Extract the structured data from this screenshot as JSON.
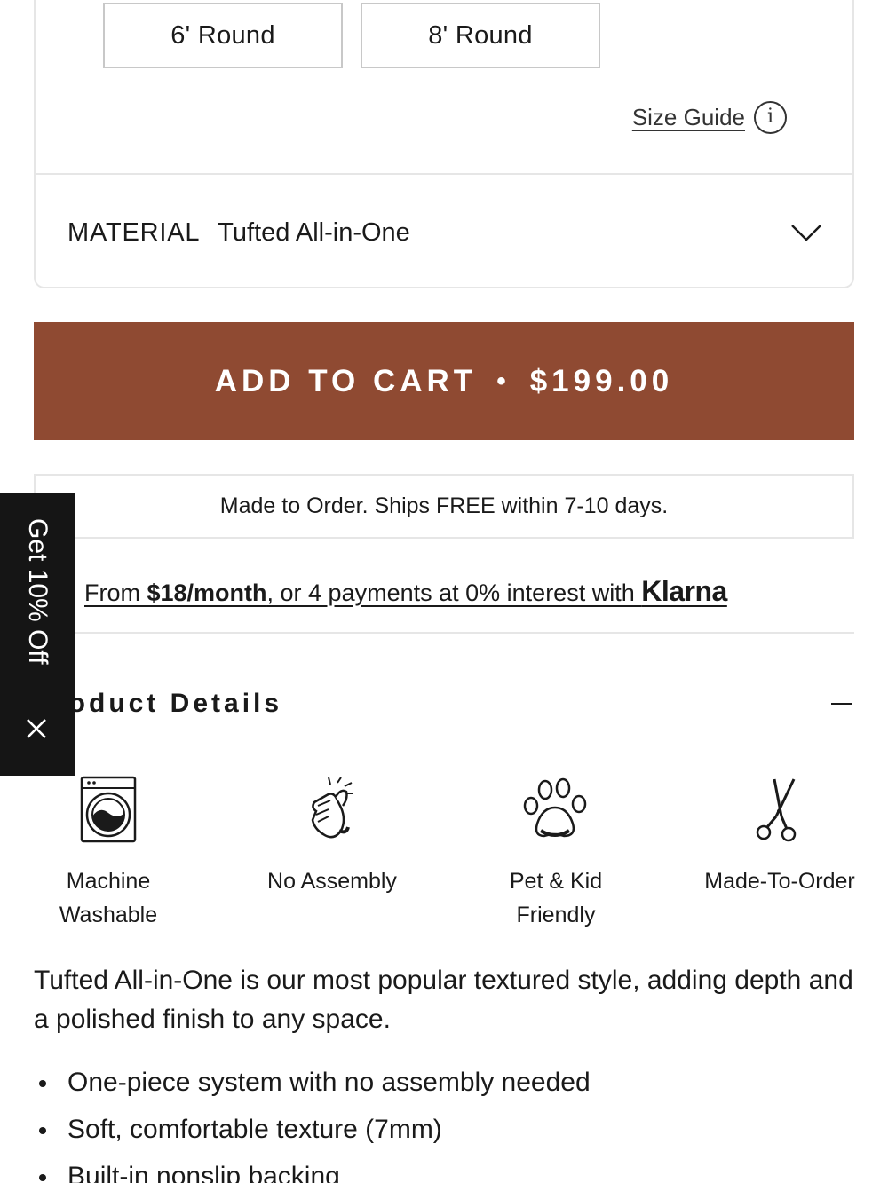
{
  "size_options": [
    {
      "label": "6' Round"
    },
    {
      "label": "8' Round"
    }
  ],
  "size_guide": {
    "label": "Size Guide",
    "icon": "info-icon"
  },
  "material": {
    "key": "MATERIAL",
    "value": "Tufted All-in-One",
    "icon": "chevron-down-icon"
  },
  "cart": {
    "label": "ADD TO CART",
    "separator": "•",
    "price": "$199.00",
    "color": "#8f4a32"
  },
  "shipping": {
    "text": "Made to Order. Ships FREE within 7-10 days."
  },
  "klarna": {
    "prefix": "From ",
    "amount": "$18/month",
    "middle": ", or 4 payments at 0% interest with ",
    "brand": "Klarna"
  },
  "product_details": {
    "title": "Product Details",
    "icon": "minus-icon"
  },
  "promo_tab": {
    "label": "Get 10% Off",
    "icon": "close-icon"
  },
  "features": [
    {
      "line1": "Machine",
      "line2": "Washable",
      "icon": "washing-machine-icon"
    },
    {
      "line1": "No Assembly",
      "line2": "",
      "icon": "snapping-hand-icon"
    },
    {
      "line1": "Pet & Kid",
      "line2": "Friendly",
      "icon": "paw-icon"
    },
    {
      "line1": "Made-To-Order",
      "line2": "",
      "icon": "scissors-icon"
    }
  ],
  "description": "Tufted All-in-One is our most popular textured style, adding depth and a polished finish to any space.",
  "bullets": [
    "One-piece system with no assembly needed",
    "Soft, comfortable texture (7mm)",
    "Built-in nonslip backing"
  ]
}
